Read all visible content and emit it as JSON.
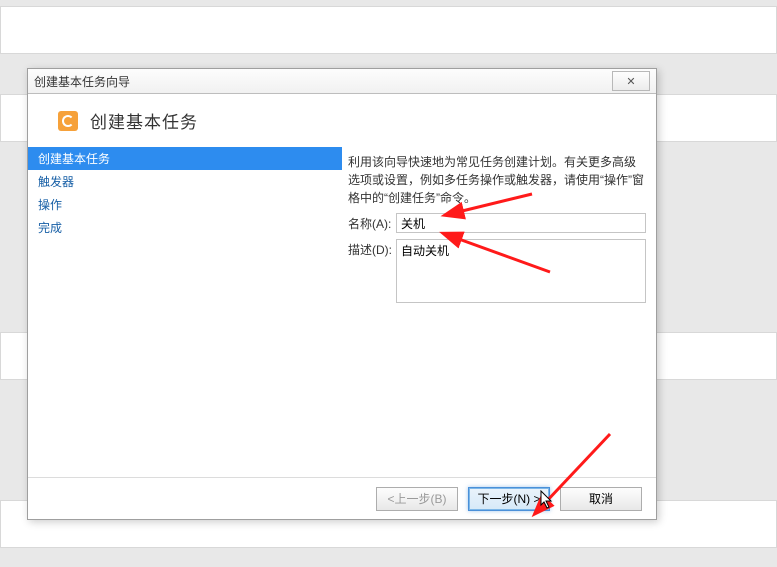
{
  "dialog": {
    "title": "创建基本任务向导",
    "close_glyph": "✕",
    "header": "创建基本任务"
  },
  "sidebar": {
    "items": [
      {
        "label": "创建基本任务",
        "active": true
      },
      {
        "label": "触发器",
        "active": false
      },
      {
        "label": "操作",
        "active": false
      },
      {
        "label": "完成",
        "active": false
      }
    ]
  },
  "content": {
    "description": "利用该向导快速地为常见任务创建计划。有关更多高级选项或设置，例如多任务操作或触发器，请使用“操作”窗格中的“创建任务”命令。",
    "name_label": "名称(A):",
    "name_value": "关机",
    "desc_label": "描述(D):",
    "desc_value": "自动关机"
  },
  "footer": {
    "back": "<上一步(B)",
    "next": "下一步(N) >",
    "cancel": "取消"
  }
}
